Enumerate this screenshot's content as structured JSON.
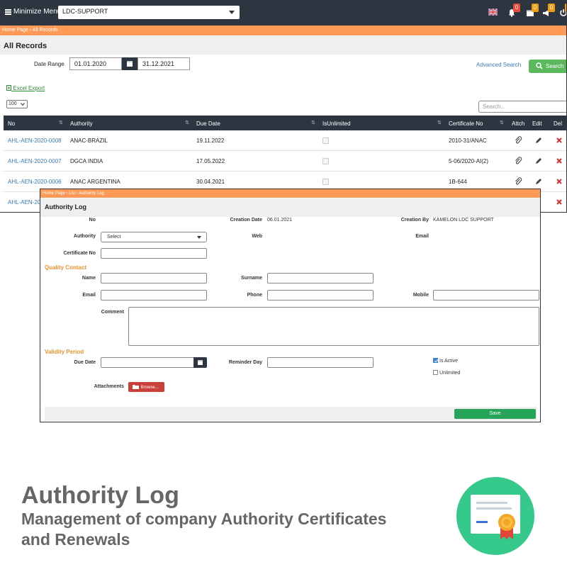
{
  "topbar": {
    "menu_label": "Minimize Menu",
    "company": "LDC-SUPPORT",
    "badges": [
      "0",
      "0",
      "0",
      "0"
    ],
    "badge_colors": [
      "#e74c3c",
      "#f39c12",
      "#f39c12",
      "#f39c12"
    ]
  },
  "list": {
    "breadcrumb": "Home Page  ›  All Records",
    "title": "All Records",
    "date_range_label": "Date Range",
    "date_from": "01.01.2020",
    "date_to": "31.12.2021",
    "advanced_search": "Advanced Search",
    "search_button": "Search",
    "excel_export": "Excel Export",
    "page_size": "100",
    "search_placeholder": "Search...",
    "columns": [
      "No",
      "Authority",
      "Due Date",
      "IsUnlimited",
      "Certificate No",
      "Attch",
      "Edit",
      "Del"
    ],
    "rows": [
      {
        "no": "AHL-AEN-2020-0008",
        "authority": "ANAC-BRAZIL",
        "due": "19.11.2022",
        "cert": "2010-31/ANAC"
      },
      {
        "no": "AHL-AEN-2020-0007",
        "authority": "DGCA INDIA",
        "due": "17.05.2022",
        "cert": "5-06/2020-AI(2)"
      },
      {
        "no": "AHL-AEN-2020-0006",
        "authority": "ANAC ARGENTINA",
        "due": "30.04.2021",
        "cert": "1B-644"
      },
      {
        "no": "AHL-AEN-20",
        "authority": "",
        "due": "",
        "cert": ""
      }
    ]
  },
  "form": {
    "breadcrumb": "Home Page  ›  List  ›  Authority Log",
    "title": "Authority Log",
    "no_label": "No",
    "creation_date_label": "Creation Date",
    "creation_date": "06.01.2021",
    "creation_by_label": "Creation By",
    "creation_by": "KAMELON LDC SUPPORT",
    "authority_label": "Authority",
    "authority_select": "Select",
    "web_label": "Web",
    "email_label_top": "Email",
    "certificate_no_label": "Certificate No",
    "quality_contact": "Quality Contact",
    "name_label": "Name",
    "surname_label": "Surname",
    "email_label": "Email",
    "phone_label": "Phone",
    "mobile_label": "Mobile",
    "comment_label": "Comment",
    "validity_period": "Validity Period",
    "due_date_label": "Due Date",
    "reminder_day_label": "Reminder Day",
    "is_active_label": "Is Active",
    "is_active": true,
    "unlimited_label": "Unlimited",
    "unlimited": false,
    "attachments_label": "Attachments",
    "browse_button": "Browse...",
    "save_button": "Save"
  },
  "promo": {
    "title": "Authority Log",
    "subtitle": "Management of company Authority Certificates and Renewals"
  },
  "colors": {
    "topbar": "#2d3640",
    "accent_orange": "#fd9a57",
    "section_orange": "#f0932a",
    "search_green": "#5cb85c",
    "save_green": "#28a35a",
    "browse_red": "#c9403a",
    "link_blue": "#3a7ab8",
    "promo_green": "#36c98c"
  }
}
